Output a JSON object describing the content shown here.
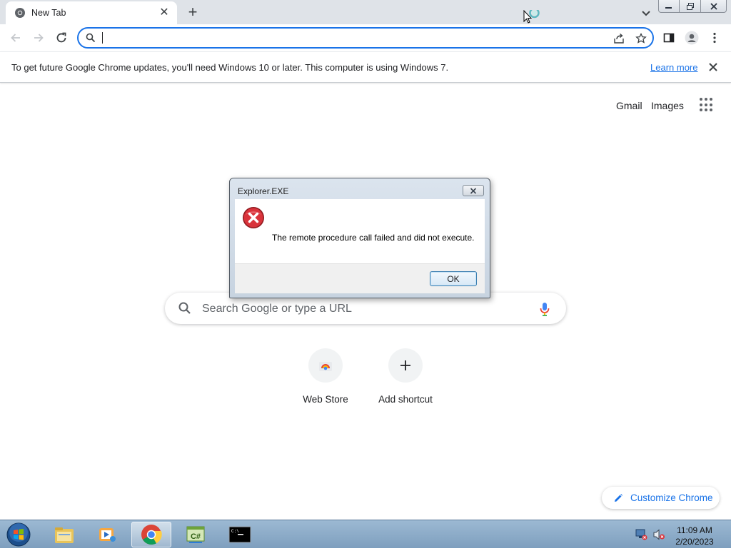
{
  "browser": {
    "tab": {
      "title": "New Tab",
      "favicon": "chrome-icon"
    },
    "omnibox": {
      "value": "",
      "placeholder": ""
    }
  },
  "infobar": {
    "message": "To get future Google Chrome updates, you'll need Windows 10 or later. This computer is using Windows 7.",
    "link": "Learn more"
  },
  "ntp": {
    "links": {
      "gmail": "Gmail",
      "images": "Images"
    },
    "search_placeholder": "Search Google or type a URL",
    "shortcuts": [
      {
        "label": "Web Store",
        "icon": "web-store-icon"
      },
      {
        "label": "Add shortcut",
        "icon": "plus-icon"
      }
    ],
    "customize_label": "Customize Chrome"
  },
  "dialog": {
    "title": "Explorer.EXE",
    "message": "The remote procedure call failed and did not execute.",
    "ok_label": "OK",
    "icon": "error-icon"
  },
  "taskbar": {
    "items": [
      {
        "icon": "start-orb-icon"
      },
      {
        "icon": "file-explorer-icon"
      },
      {
        "icon": "media-player-icon"
      },
      {
        "icon": "chrome-icon",
        "active": true
      },
      {
        "icon": "csharp-icon"
      },
      {
        "icon": "command-prompt-icon"
      }
    ],
    "tray": {
      "time": "11:09 AM",
      "date": "2/20/2023"
    }
  },
  "colors": {
    "accent": "#1a73e8",
    "error_red": "#c4202b",
    "tabstrip": "#dfe3e8",
    "taskbar": "#8fadc9"
  }
}
